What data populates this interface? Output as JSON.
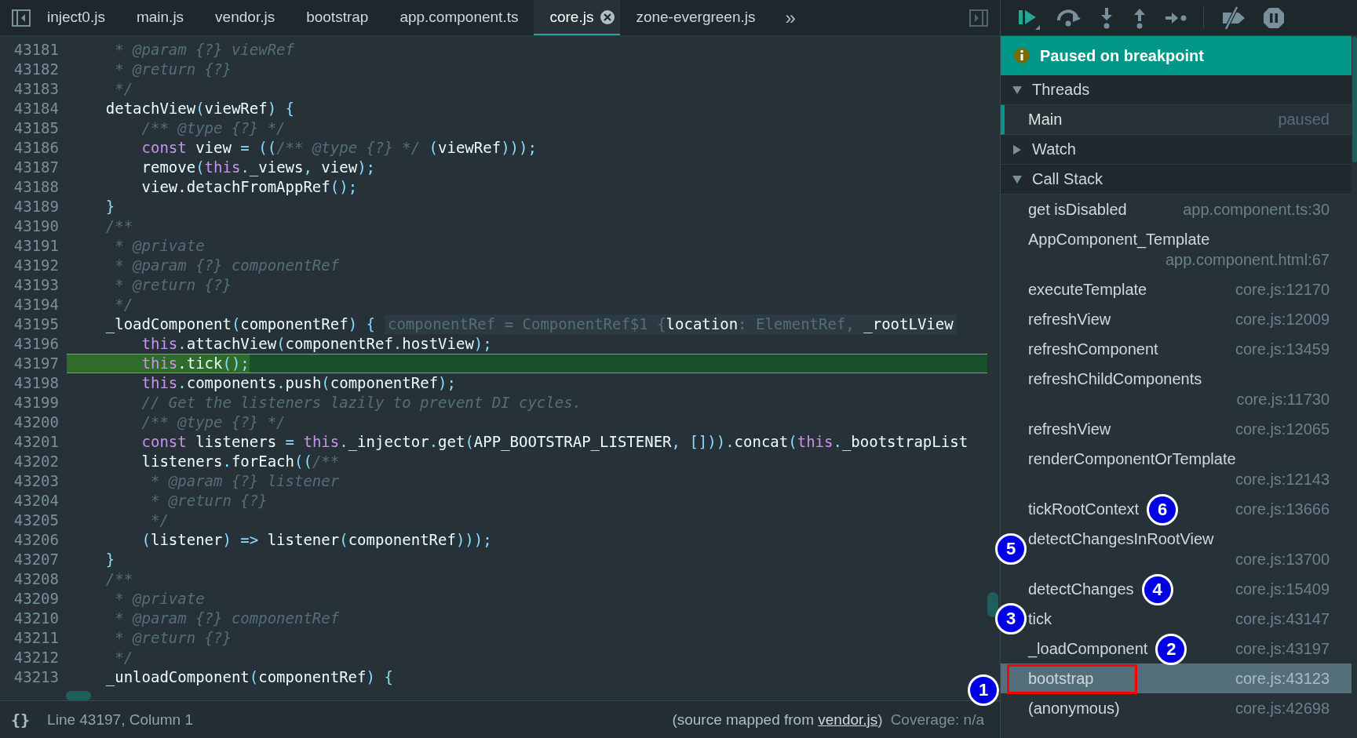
{
  "tabs": [
    {
      "label": "inject0.js",
      "selected": false
    },
    {
      "label": "main.js",
      "selected": false
    },
    {
      "label": "vendor.js",
      "selected": false
    },
    {
      "label": "bootstrap",
      "selected": false
    },
    {
      "label": "app.component.ts",
      "selected": false
    },
    {
      "label": "core.js",
      "selected": true
    },
    {
      "label": "zone-evergreen.js",
      "selected": false
    }
  ],
  "tabs_overflow": "»",
  "editor": {
    "lines": [
      {
        "number": "43181",
        "current": false,
        "segments": [
          {
            "kind": "comment",
            "text": "     * @param {?} viewRef"
          }
        ]
      },
      {
        "number": "43182",
        "current": false,
        "segments": [
          {
            "kind": "comment",
            "text": "     * @return {?}"
          }
        ]
      },
      {
        "number": "43183",
        "current": false,
        "segments": [
          {
            "kind": "comment",
            "text": "     */"
          }
        ]
      },
      {
        "number": "43184",
        "current": false,
        "segments": [
          {
            "kind": "plain",
            "text": "    detachView"
          },
          {
            "kind": "punct",
            "text": "("
          },
          {
            "kind": "plain",
            "text": "viewRef"
          },
          {
            "kind": "punct",
            "text": ") {"
          }
        ]
      },
      {
        "number": "43185",
        "current": false,
        "segments": [
          {
            "kind": "comment",
            "text": "        /** @type {?} */"
          }
        ]
      },
      {
        "number": "43186",
        "current": false,
        "segments": [
          {
            "kind": "keyword",
            "text": "        const"
          },
          {
            "kind": "plain",
            "text": " view "
          },
          {
            "kind": "punct",
            "text": "= (("
          },
          {
            "kind": "comment",
            "text": "/** @type {?} */"
          },
          {
            "kind": "punct",
            "text": " ("
          },
          {
            "kind": "plain",
            "text": "viewRef"
          },
          {
            "kind": "punct",
            "text": ")));"
          }
        ]
      },
      {
        "number": "43187",
        "current": false,
        "segments": [
          {
            "kind": "plain",
            "text": "        remove"
          },
          {
            "kind": "punct",
            "text": "("
          },
          {
            "kind": "keyword",
            "text": "this"
          },
          {
            "kind": "punct",
            "text": "."
          },
          {
            "kind": "plain",
            "text": "_views"
          },
          {
            "kind": "punct",
            "text": ", "
          },
          {
            "kind": "plain",
            "text": "view"
          },
          {
            "kind": "punct",
            "text": ");"
          }
        ]
      },
      {
        "number": "43188",
        "current": false,
        "segments": [
          {
            "kind": "plain",
            "text": "        view"
          },
          {
            "kind": "plain",
            "text": ".detachFromAppRef"
          },
          {
            "kind": "punct",
            "text": "();"
          }
        ]
      },
      {
        "number": "43189",
        "current": false,
        "segments": [
          {
            "kind": "punct",
            "text": "    }"
          }
        ]
      },
      {
        "number": "43190",
        "current": false,
        "segments": [
          {
            "kind": "comment",
            "text": "    /**"
          }
        ]
      },
      {
        "number": "43191",
        "current": false,
        "segments": [
          {
            "kind": "comment",
            "text": "     * @private"
          }
        ]
      },
      {
        "number": "43192",
        "current": false,
        "segments": [
          {
            "kind": "comment",
            "text": "     * @param {?} componentRef"
          }
        ]
      },
      {
        "number": "43193",
        "current": false,
        "segments": [
          {
            "kind": "comment",
            "text": "     * @return {?}"
          }
        ]
      },
      {
        "number": "43194",
        "current": false,
        "segments": [
          {
            "kind": "comment",
            "text": "     */"
          }
        ]
      },
      {
        "number": "43195",
        "current": false,
        "segments": [
          {
            "kind": "plain",
            "text": "    _loadComponent"
          },
          {
            "kind": "punct",
            "text": "("
          },
          {
            "kind": "plain",
            "text": "componentRef"
          },
          {
            "kind": "punct",
            "text": ") {"
          }
        ],
        "inline_value": [
          {
            "kind": "hint",
            "text": "componentRef = ComponentRef$1 {"
          },
          {
            "kind": "plain",
            "text": "location"
          },
          {
            "kind": "hint",
            "text": ": ElementRef, "
          },
          {
            "kind": "plain",
            "text": "_rootLView"
          }
        ]
      },
      {
        "number": "43196",
        "current": false,
        "segments": [
          {
            "kind": "keyword",
            "text": "        this"
          },
          {
            "kind": "punct",
            "text": "."
          },
          {
            "kind": "plain",
            "text": "attachView"
          },
          {
            "kind": "punct",
            "text": "("
          },
          {
            "kind": "plain",
            "text": "componentRef"
          },
          {
            "kind": "punct",
            "text": "."
          },
          {
            "kind": "plain",
            "text": "hostView"
          },
          {
            "kind": "punct",
            "text": ");"
          }
        ]
      },
      {
        "number": "43197",
        "current": true,
        "segments": [
          {
            "kind": "keyword",
            "text": "        this"
          },
          {
            "kind": "plain",
            "text": ".tick"
          },
          {
            "kind": "punct",
            "text": "();"
          }
        ]
      },
      {
        "number": "43198",
        "current": false,
        "segments": [
          {
            "kind": "keyword",
            "text": "        this"
          },
          {
            "kind": "punct",
            "text": "."
          },
          {
            "kind": "plain",
            "text": "components"
          },
          {
            "kind": "punct",
            "text": "."
          },
          {
            "kind": "plain",
            "text": "push"
          },
          {
            "kind": "punct",
            "text": "("
          },
          {
            "kind": "plain",
            "text": "componentRef"
          },
          {
            "kind": "punct",
            "text": ");"
          }
        ]
      },
      {
        "number": "43199",
        "current": false,
        "segments": [
          {
            "kind": "comment",
            "text": "        // Get the listeners lazily to prevent DI cycles."
          }
        ]
      },
      {
        "number": "43200",
        "current": false,
        "segments": [
          {
            "kind": "comment",
            "text": "        /** @type {?} */"
          }
        ]
      },
      {
        "number": "43201",
        "current": false,
        "segments": [
          {
            "kind": "keyword",
            "text": "        const"
          },
          {
            "kind": "plain",
            "text": " listeners "
          },
          {
            "kind": "punct",
            "text": "= "
          },
          {
            "kind": "keyword",
            "text": "this"
          },
          {
            "kind": "punct",
            "text": "."
          },
          {
            "kind": "plain",
            "text": "_injector"
          },
          {
            "kind": "punct",
            "text": "."
          },
          {
            "kind": "plain",
            "text": "get"
          },
          {
            "kind": "punct",
            "text": "("
          },
          {
            "kind": "plain",
            "text": "APP_BOOTSTRAP_LISTENER"
          },
          {
            "kind": "punct",
            "text": ", []))."
          },
          {
            "kind": "plain",
            "text": "concat"
          },
          {
            "kind": "punct",
            "text": "("
          },
          {
            "kind": "keyword",
            "text": "this"
          },
          {
            "kind": "punct",
            "text": "."
          },
          {
            "kind": "plain",
            "text": "_bootstrapList"
          }
        ]
      },
      {
        "number": "43202",
        "current": false,
        "segments": [
          {
            "kind": "plain",
            "text": "        listeners"
          },
          {
            "kind": "punct",
            "text": "."
          },
          {
            "kind": "plain",
            "text": "forEach"
          },
          {
            "kind": "punct",
            "text": "(("
          },
          {
            "kind": "comment",
            "text": "/**"
          }
        ]
      },
      {
        "number": "43203",
        "current": false,
        "segments": [
          {
            "kind": "comment",
            "text": "         * @param {?} listener"
          }
        ]
      },
      {
        "number": "43204",
        "current": false,
        "segments": [
          {
            "kind": "comment",
            "text": "         * @return {?}"
          }
        ]
      },
      {
        "number": "43205",
        "current": false,
        "segments": [
          {
            "kind": "comment",
            "text": "         */"
          }
        ]
      },
      {
        "number": "43206",
        "current": false,
        "segments": [
          {
            "kind": "punct",
            "text": "        ("
          },
          {
            "kind": "plain",
            "text": "listener"
          },
          {
            "kind": "punct",
            "text": ") => "
          },
          {
            "kind": "plain",
            "text": "listener"
          },
          {
            "kind": "punct",
            "text": "("
          },
          {
            "kind": "plain",
            "text": "componentRef"
          },
          {
            "kind": "punct",
            "text": ")));"
          }
        ]
      },
      {
        "number": "43207",
        "current": false,
        "segments": [
          {
            "kind": "punct",
            "text": "    }"
          }
        ]
      },
      {
        "number": "43208",
        "current": false,
        "segments": [
          {
            "kind": "comment",
            "text": "    /**"
          }
        ]
      },
      {
        "number": "43209",
        "current": false,
        "segments": [
          {
            "kind": "comment",
            "text": "     * @private"
          }
        ]
      },
      {
        "number": "43210",
        "current": false,
        "segments": [
          {
            "kind": "comment",
            "text": "     * @param {?} componentRef"
          }
        ]
      },
      {
        "number": "43211",
        "current": false,
        "segments": [
          {
            "kind": "comment",
            "text": "     * @return {?}"
          }
        ]
      },
      {
        "number": "43212",
        "current": false,
        "segments": [
          {
            "kind": "comment",
            "text": "     */"
          }
        ]
      },
      {
        "number": "43213",
        "current": false,
        "segments": [
          {
            "kind": "plain",
            "text": "    _unloadComponent"
          },
          {
            "kind": "punct",
            "text": "("
          },
          {
            "kind": "plain",
            "text": "componentRef"
          },
          {
            "kind": "punct",
            "text": ") {"
          }
        ]
      }
    ]
  },
  "status_bar": {
    "format_button": "{}",
    "position": "Line 43197, Column 1",
    "source_prefix": "(source mapped from ",
    "source_link": "vendor.js",
    "source_suffix": ")",
    "coverage": "Coverage: n/a"
  },
  "debugger": {
    "banner": "Paused on breakpoint",
    "threads": {
      "title": "Threads",
      "expanded": true,
      "items": [
        {
          "name": "Main",
          "status": "paused",
          "selected": true
        }
      ]
    },
    "watch": {
      "title": "Watch",
      "expanded": false
    },
    "call_stack": {
      "title": "Call Stack",
      "expanded": true,
      "frames": [
        {
          "name": "get isDisabled",
          "location": "app.component.ts:30",
          "selected": false
        },
        {
          "name": "AppComponent_Template",
          "location": "app.component.html:67",
          "selected": false
        },
        {
          "name": "executeTemplate",
          "location": "core.js:12170",
          "selected": false
        },
        {
          "name": "refreshView",
          "location": "core.js:12009",
          "selected": false
        },
        {
          "name": "refreshComponent",
          "location": "core.js:13459",
          "selected": false
        },
        {
          "name": "refreshChildComponents",
          "location": "core.js:11730",
          "selected": false
        },
        {
          "name": "refreshView",
          "location": "core.js:12065",
          "selected": false
        },
        {
          "name": "renderComponentOrTemplate",
          "location": "core.js:12143",
          "selected": false
        },
        {
          "name": "tickRootContext",
          "location": "core.js:13666",
          "selected": false,
          "badge": "6"
        },
        {
          "name": "detectChangesInRootView",
          "location": "core.js:13700",
          "selected": false,
          "badge": "5"
        },
        {
          "name": "detectChanges",
          "location": "core.js:15409",
          "selected": false,
          "badge": "4"
        },
        {
          "name": "tick",
          "location": "core.js:43147",
          "selected": false,
          "badge": "3"
        },
        {
          "name": "_loadComponent",
          "location": "core.js:43197",
          "selected": false,
          "badge": "2"
        },
        {
          "name": "bootstrap",
          "location": "core.js:43123",
          "selected": true,
          "outlined": true,
          "badge": "1"
        },
        {
          "name": "(anonymous)",
          "location": "core.js:42698",
          "selected": false
        }
      ]
    }
  }
}
